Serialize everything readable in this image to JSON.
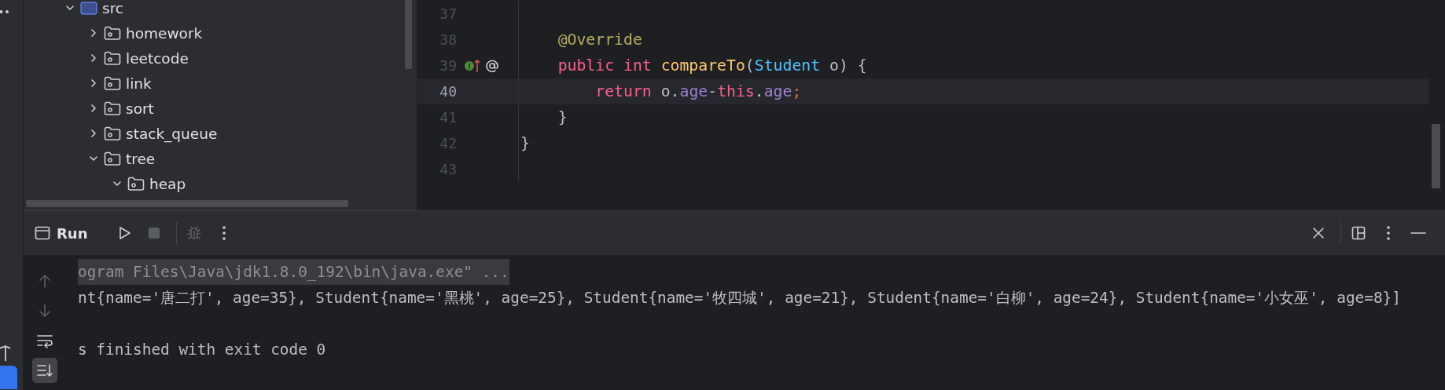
{
  "project_tree": [
    {
      "label": "src",
      "kind": "source",
      "expanded": true,
      "children": [
        {
          "label": "homework",
          "kind": "package",
          "expanded": false
        },
        {
          "label": "leetcode",
          "kind": "package",
          "expanded": false
        },
        {
          "label": "link",
          "kind": "package",
          "expanded": false
        },
        {
          "label": "sort",
          "kind": "package",
          "expanded": false
        },
        {
          "label": "stack_queue",
          "kind": "package",
          "expanded": false
        },
        {
          "label": "tree",
          "kind": "package",
          "expanded": true,
          "children": [
            {
              "label": "heap",
              "kind": "package",
              "expanded": true
            }
          ]
        }
      ]
    }
  ],
  "editor": {
    "lines": [
      {
        "number": "37",
        "current": false
      },
      {
        "number": "38",
        "current": false,
        "tokens": [
          {
            "kind": "annotation",
            "text": "    @Override"
          }
        ]
      },
      {
        "number": "39",
        "current": false,
        "markers": [
          {
            "kind": "implements"
          },
          {
            "kind": "annotated"
          }
        ],
        "tokens": [
          {
            "kind": "keyword",
            "text": "    public"
          },
          {
            "kind": "keyword",
            "text": " int"
          },
          {
            "kind": "method",
            "text": " compareTo"
          },
          {
            "kind": "plain",
            "text": "("
          },
          {
            "kind": "type",
            "text": "Student"
          },
          {
            "kind": "plain",
            "text": " o) {"
          }
        ]
      },
      {
        "number": "40",
        "current": true,
        "tokens": [
          {
            "kind": "keyword",
            "text": "        return"
          },
          {
            "kind": "plain",
            "text": " o."
          },
          {
            "kind": "field",
            "text": "age"
          },
          {
            "kind": "plain",
            "text": "-"
          },
          {
            "kind": "keyword",
            "text": "this"
          },
          {
            "kind": "plain",
            "text": "."
          },
          {
            "kind": "field",
            "text": "age"
          },
          {
            "kind": "semicolon",
            "text": ";"
          }
        ]
      },
      {
        "number": "41",
        "current": false,
        "tokens": [
          {
            "kind": "plain",
            "text": "    }"
          }
        ]
      },
      {
        "number": "42",
        "current": false,
        "tokens": [
          {
            "kind": "plain",
            "text": "}"
          }
        ]
      },
      {
        "number": "43",
        "current": false
      }
    ]
  },
  "run_panel": {
    "title": "Run",
    "toolbar": [
      {
        "kind": "rerun",
        "disabled": false
      },
      {
        "kind": "stop",
        "disabled": true
      },
      {
        "kind": "divider"
      },
      {
        "kind": "debug",
        "disabled": true
      },
      {
        "kind": "more",
        "disabled": false
      }
    ],
    "right_toolbar": [
      {
        "kind": "close"
      },
      {
        "kind": "divider"
      },
      {
        "kind": "layout"
      },
      {
        "kind": "more"
      },
      {
        "kind": "minimize"
      }
    ],
    "console_tools": [
      {
        "kind": "up",
        "disabled": true,
        "selected": false
      },
      {
        "kind": "down",
        "disabled": true,
        "selected": false
      },
      {
        "kind": "wrap",
        "disabled": false,
        "selected": false
      },
      {
        "kind": "scroll-end",
        "disabled": false,
        "selected": true
      }
    ],
    "console": [
      {
        "kind": "command",
        "text": "ogram Files\\Java\\jdk1.8.0_192\\bin\\java.exe\" ..."
      },
      {
        "kind": "output",
        "text": "nt{name='唐二打', age=35}, Student{name='黑桃', age=25}, Student{name='牧四城', age=21}, Student{name='白柳', age=24}, Student{name='小女巫', age=8}]"
      },
      {
        "kind": "blank"
      },
      {
        "kind": "output",
        "text": "s finished with exit code 0"
      }
    ]
  }
}
